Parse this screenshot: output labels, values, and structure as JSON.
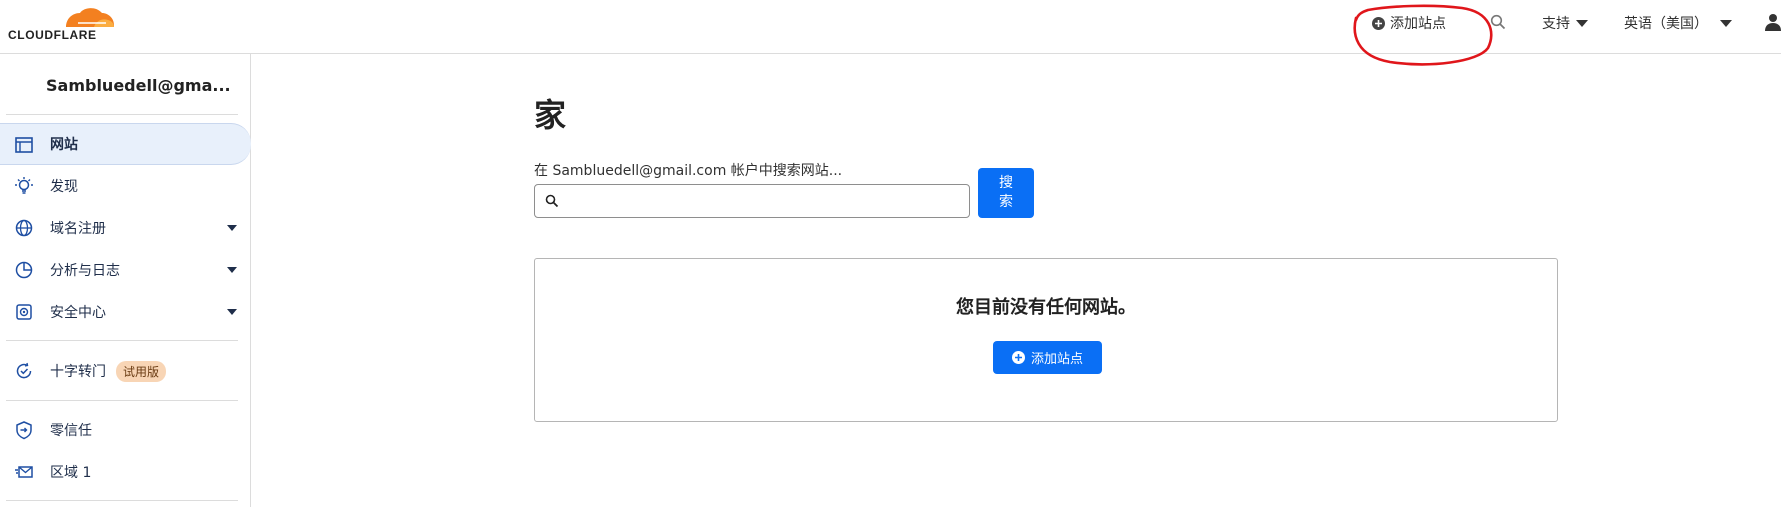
{
  "brand": {
    "name": "CLOUDFLARE",
    "accent": "#f38020"
  },
  "topbar": {
    "add_site_label": "添加站点",
    "support_label": "支持",
    "language_label": "英语（美国）",
    "annotation_color": "#e0161b"
  },
  "sidebar": {
    "account_name": "Sambluedell@gma...",
    "items": [
      {
        "label": "网站",
        "icon": "window-icon",
        "active": true
      },
      {
        "label": "发现",
        "icon": "lightbulb-icon"
      },
      {
        "label": "域名注册",
        "icon": "globe-icon",
        "dropdown": true
      },
      {
        "label": "分析与日志",
        "icon": "pie-chart-icon",
        "dropdown": true
      },
      {
        "label": "安全中心",
        "icon": "security-center-icon",
        "dropdown": true
      },
      {
        "label": "十字转门",
        "icon": "turnstile-icon",
        "badge": "试用版"
      },
      {
        "label": "零信任",
        "icon": "shield-icon"
      },
      {
        "label": "区域 1",
        "icon": "mail-icon"
      }
    ]
  },
  "main": {
    "title": "家",
    "search": {
      "label": "在 Sambluedell@gmail.com 帐户中搜索网站...",
      "value": "",
      "button_line1": "搜",
      "button_line2": "索"
    },
    "empty_state": {
      "message": "您目前没有任何网站。",
      "button_label": "添加站点"
    }
  },
  "colors": {
    "primary": "#0a6ff5",
    "active_bg": "#e8f0fb",
    "badge_bg": "#f8d5b5"
  }
}
